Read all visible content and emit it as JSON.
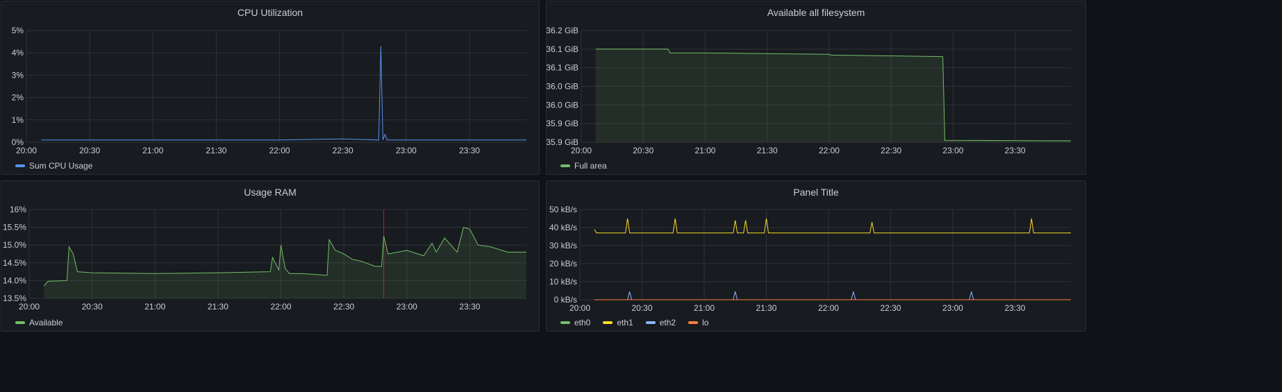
{
  "colors": {
    "panel_bg": "#181b1f",
    "grid": "#2f3238",
    "text": "#ccccdc"
  },
  "panels": [
    {
      "title": "CPU Utilization"
    },
    {
      "title": "Available all filesystem"
    },
    {
      "title": "Usage RAM"
    },
    {
      "title": "Panel Title"
    }
  ],
  "chart_data": [
    {
      "type": "line",
      "title": "CPU Utilization",
      "x_ticks": [
        "20:00",
        "20:30",
        "21:00",
        "21:30",
        "22:00",
        "22:30",
        "23:00",
        "23:30"
      ],
      "y_ticks": [
        "0%",
        "1%",
        "2%",
        "3%",
        "4%",
        "5%"
      ],
      "ylim": [
        0,
        5
      ],
      "x_range": [
        "20:00",
        "23:57"
      ],
      "grid": true,
      "legend_placement": "bottom-left",
      "series": [
        {
          "name": "Sum CPU Usage",
          "color": "#5794f2",
          "x": [
            "20:07",
            "20:30",
            "21:00",
            "21:30",
            "22:00",
            "22:30",
            "22:47",
            "22:48",
            "22:49",
            "22:50",
            "22:51",
            "23:00",
            "23:30",
            "23:57"
          ],
          "values": [
            0.1,
            0.1,
            0.1,
            0.1,
            0.1,
            0.15,
            0.1,
            4.3,
            0.1,
            0.35,
            0.1,
            0.1,
            0.1,
            0.1
          ]
        }
      ]
    },
    {
      "type": "area",
      "title": "Available all filesystem",
      "x_ticks": [
        "20:00",
        "20:30",
        "21:00",
        "21:30",
        "22:00",
        "22:30",
        "23:00",
        "23:30"
      ],
      "y_ticks": [
        "35.9 GiB",
        "35.9 GiB",
        "36.0 GiB",
        "36.0 GiB",
        "36.1 GiB",
        "36.1 GiB",
        "36.2 GiB"
      ],
      "ylim": [
        35.85,
        36.15
      ],
      "x_range": [
        "20:00",
        "23:57"
      ],
      "grid": true,
      "legend_placement": "bottom-left",
      "series": [
        {
          "name": "Full area",
          "color": "#73bf69",
          "x": [
            "20:07",
            "20:42",
            "20:43",
            "21:00",
            "21:30",
            "22:00",
            "22:01",
            "22:30",
            "22:55",
            "22:56",
            "23:57"
          ],
          "values": [
            36.1,
            36.1,
            36.09,
            36.09,
            36.088,
            36.086,
            36.084,
            36.082,
            36.08,
            35.855,
            35.854
          ]
        }
      ]
    },
    {
      "type": "area",
      "title": "Usage RAM",
      "x_ticks": [
        "20:00",
        "20:30",
        "21:00",
        "21:30",
        "22:00",
        "22:30",
        "23:00",
        "23:30"
      ],
      "y_ticks": [
        "13.5%",
        "14.0%",
        "14.5%",
        "15.0%",
        "15.5%",
        "16%"
      ],
      "ylim": [
        13.5,
        16
      ],
      "x_range": [
        "20:00",
        "23:57"
      ],
      "grid": true,
      "legend_placement": "bottom-left",
      "series": [
        {
          "name": "Available",
          "color": "#73bf69",
          "x": [
            "20:07",
            "20:09",
            "20:18",
            "20:19",
            "20:21",
            "20:23",
            "20:30",
            "21:00",
            "21:30",
            "21:55",
            "21:56",
            "21:59",
            "22:00",
            "22:02",
            "22:04",
            "22:06",
            "22:10",
            "22:22",
            "22:23",
            "22:26",
            "22:30",
            "22:34",
            "22:38",
            "22:45",
            "22:48",
            "22:49",
            "22:51",
            "23:00",
            "23:08",
            "23:12",
            "23:14",
            "23:18",
            "23:24",
            "23:27",
            "23:30",
            "23:34",
            "23:40",
            "23:48",
            "23:57"
          ],
          "values": [
            13.85,
            13.98,
            14.0,
            14.95,
            14.75,
            14.25,
            14.22,
            14.2,
            14.22,
            14.25,
            14.65,
            14.3,
            15.0,
            14.35,
            14.2,
            14.2,
            14.2,
            14.15,
            15.15,
            14.85,
            14.75,
            14.6,
            14.55,
            14.4,
            14.4,
            15.25,
            14.75,
            14.85,
            14.7,
            15.05,
            14.8,
            15.2,
            14.8,
            15.5,
            15.45,
            15.0,
            14.95,
            14.8,
            14.8
          ]
        }
      ],
      "annotation_x": "22:49"
    },
    {
      "type": "line",
      "title": "Panel Title",
      "x_ticks": [
        "20:00",
        "20:30",
        "21:00",
        "21:30",
        "22:00",
        "22:30",
        "23:00",
        "23:30"
      ],
      "y_ticks": [
        "0 kB/s",
        "10 kB/s",
        "20 kB/s",
        "30 kB/s",
        "40 kB/s",
        "50 kB/s"
      ],
      "ylim": [
        0,
        50
      ],
      "x_range": [
        "20:00",
        "23:57"
      ],
      "grid": true,
      "legend_placement": "bottom-left",
      "series": [
        {
          "name": "eth0",
          "color": "#73bf69",
          "x": [
            "20:07",
            "23:57"
          ],
          "values": [
            0,
            0
          ]
        },
        {
          "name": "eth1",
          "color": "#fade2a",
          "x": [
            "20:07",
            "20:08",
            "20:22",
            "20:23",
            "20:24",
            "20:45",
            "20:46",
            "20:47",
            "21:14",
            "21:15",
            "21:16",
            "21:19",
            "21:20",
            "21:21",
            "21:29",
            "21:30",
            "21:31",
            "22:20",
            "22:21",
            "22:22",
            "23:37",
            "23:38",
            "23:39",
            "23:57"
          ],
          "values": [
            39,
            37,
            37,
            45,
            37,
            37,
            45,
            37,
            37,
            44,
            37,
            37,
            44,
            37,
            37,
            45,
            37,
            37,
            43,
            37,
            37,
            45,
            37,
            37
          ]
        },
        {
          "name": "eth2",
          "color": "#8ab8ff",
          "x": [
            "20:07",
            "20:23",
            "20:24",
            "20:25",
            "21:14",
            "21:15",
            "21:16",
            "22:11",
            "22:12",
            "22:13",
            "23:08",
            "23:09",
            "23:10",
            "23:57"
          ],
          "values": [
            0,
            0,
            4.5,
            0,
            0,
            4.5,
            0,
            0,
            4.5,
            0,
            0,
            4.5,
            0,
            0
          ]
        },
        {
          "name": "lo",
          "color": "#ff7f3f",
          "x": [
            "20:07",
            "23:57"
          ],
          "values": [
            0,
            0
          ]
        }
      ]
    }
  ]
}
